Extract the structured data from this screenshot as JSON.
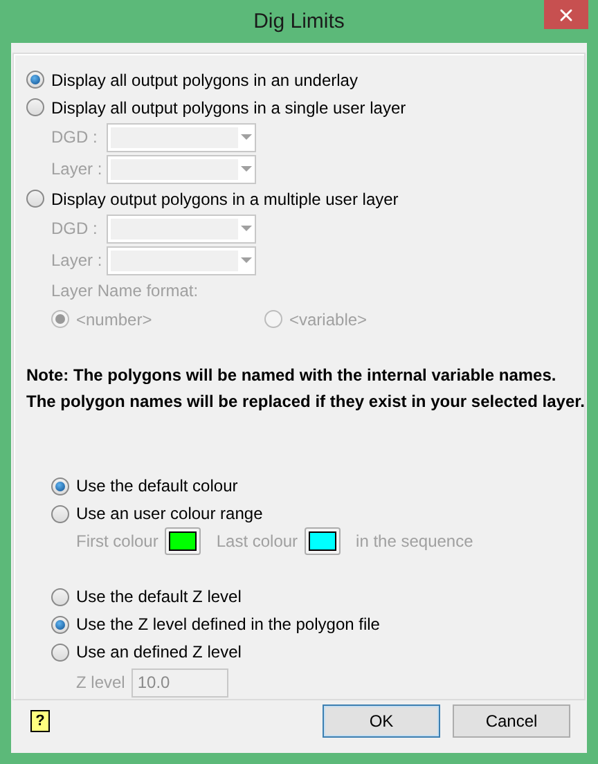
{
  "window": {
    "title": "Dig Limits"
  },
  "output_modes": [
    {
      "label": "Display all output polygons in an underlay",
      "selected": true
    },
    {
      "label": "Display all output polygons in a single user layer",
      "selected": false,
      "fields": [
        {
          "label": "DGD :",
          "disabled": true
        },
        {
          "label": "Layer :",
          "disabled": true
        }
      ]
    },
    {
      "label": "Display output polygons in a multiple user layer",
      "selected": false,
      "fields": [
        {
          "label": "DGD :",
          "disabled": true
        },
        {
          "label": "Layer :",
          "disabled": true
        }
      ],
      "name_format": {
        "label": "Layer Name format:",
        "disabled": true,
        "options": [
          {
            "label": "<number>",
            "selected": true
          },
          {
            "label": "<variable>",
            "selected": false
          }
        ]
      }
    }
  ],
  "note": [
    "Note: The polygons will be named with the internal variable names.",
    "The polygon names will be replaced if they exist in your selected layer."
  ],
  "colour_modes": [
    {
      "label": "Use the default colour",
      "selected": true
    },
    {
      "label": "Use an user colour range",
      "selected": false,
      "range": {
        "disabled": true,
        "parts": [
          {
            "kind": "text",
            "label": "First colour"
          },
          {
            "kind": "swatch",
            "color": "#00ff00"
          },
          {
            "kind": "text",
            "label": "Last colour"
          },
          {
            "kind": "swatch",
            "color": "#00ffff"
          },
          {
            "kind": "text",
            "label": "in the sequence"
          }
        ]
      }
    }
  ],
  "z_modes": [
    {
      "label": "Use the default Z level",
      "selected": false
    },
    {
      "label": "Use the Z level defined in the polygon file",
      "selected": true
    },
    {
      "label": "Use an defined Z level",
      "selected": false,
      "z_field": {
        "label": "Z level",
        "value": "10.0",
        "disabled": true
      }
    }
  ],
  "help": {
    "label": "?"
  },
  "buttons": [
    {
      "label": "OK",
      "default": true
    },
    {
      "label": "Cancel",
      "default": false
    }
  ]
}
